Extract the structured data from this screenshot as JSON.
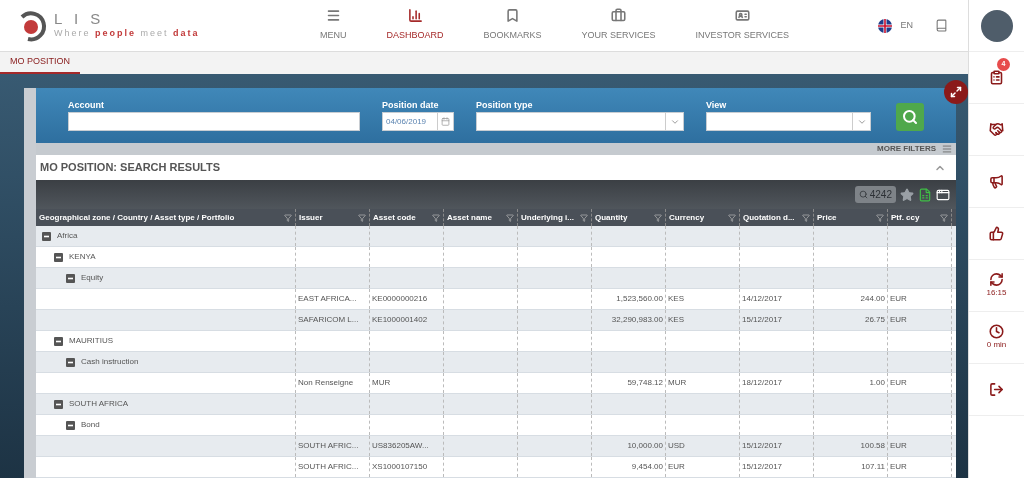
{
  "logo": {
    "letters": "L I S",
    "tagline": "Where **people** meet **data**"
  },
  "nav": [
    {
      "label": "MENU",
      "kind": "menu",
      "selected": false
    },
    {
      "label": "DASHBOARD",
      "kind": "chart",
      "selected": true
    },
    {
      "label": "BOOKMARKS",
      "kind": "bookmark",
      "selected": false
    },
    {
      "label": "YOUR SERVICES",
      "kind": "briefcase",
      "selected": false
    },
    {
      "label": "INVESTOR SERVICES",
      "kind": "card",
      "selected": false
    }
  ],
  "language": "EN",
  "tabs": [
    {
      "label": "MO POSITION",
      "selected": true
    }
  ],
  "filters": {
    "account": {
      "label": "Account"
    },
    "position_date": {
      "label": "Position date",
      "value": "04/06/2019"
    },
    "position_type": {
      "label": "Position type"
    },
    "view": {
      "label": "View"
    },
    "more_filters": "MORE FILTERS"
  },
  "results": {
    "title": "MO POSITION: SEARCH RESULTS",
    "count": "4242",
    "columns": [
      "Geographical zone / Country / Asset type / Portfolio",
      "Issuer",
      "Asset code",
      "Asset name",
      "Underlying i...",
      "Quantity",
      "Currency",
      "Quotation d...",
      "Price",
      "Ptf. ccy"
    ],
    "rows": [
      {
        "label": "Africa",
        "expanded": true,
        "children": [
          {
            "label": "KENYA",
            "expanded": true,
            "children": [
              {
                "label": "Equity",
                "expanded": true,
                "children": [
                  {
                    "issuer": "EAST AFRICA...",
                    "asset_code": "KE0000000216",
                    "quantity": "1,523,560.00",
                    "currency": "KES",
                    "quotation_date": "14/12/2017",
                    "price": "244.00",
                    "ptf_ccy": "EUR"
                  },
                  {
                    "issuer": "SAFARICOM L...",
                    "asset_code": "KE1000001402",
                    "quantity": "32,290,983.00",
                    "currency": "KES",
                    "quotation_date": "15/12/2017",
                    "price": "26.75",
                    "ptf_ccy": "EUR"
                  }
                ]
              }
            ]
          },
          {
            "label": "MAURITIUS",
            "expanded": true,
            "children": [
              {
                "label": "Cash instruction",
                "expanded": true,
                "children": [
                  {
                    "issuer": "Non Renseigne",
                    "asset_code": "MUR",
                    "quantity": "59,748.12",
                    "currency": "MUR",
                    "quotation_date": "18/12/2017",
                    "price": "1.00",
                    "ptf_ccy": "EUR"
                  }
                ]
              }
            ]
          },
          {
            "label": "SOUTH AFRICA",
            "expanded": true,
            "children": [
              {
                "label": "Bond",
                "expanded": true,
                "children": [
                  {
                    "issuer": "SOUTH AFRIC...",
                    "asset_code": "US836205AW...",
                    "quantity": "10,000.00",
                    "currency": "USD",
                    "quotation_date": "15/12/2017",
                    "price": "100.58",
                    "ptf_ccy": "EUR"
                  },
                  {
                    "issuer": "SOUTH AFRIC...",
                    "asset_code": "XS1000107150",
                    "quantity": "9,454.00",
                    "currency": "EUR",
                    "quotation_date": "15/12/2017",
                    "price": "107.11",
                    "ptf_ccy": "EUR"
                  }
                ]
              }
            ]
          }
        ]
      }
    ]
  },
  "sidebar": [
    {
      "kind": "avatar"
    },
    {
      "kind": "tasks",
      "badge": "4"
    },
    {
      "kind": "handshake"
    },
    {
      "kind": "megaphone"
    },
    {
      "kind": "like"
    },
    {
      "kind": "refresh",
      "caption": "16:15"
    },
    {
      "kind": "clock",
      "caption": "0 min"
    },
    {
      "kind": "logout"
    }
  ]
}
